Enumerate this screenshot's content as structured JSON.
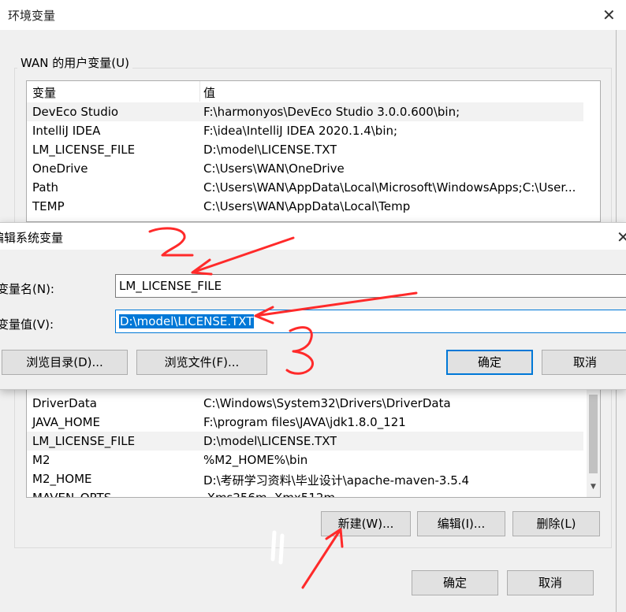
{
  "outer": {
    "title": "环境变量",
    "user_group_label": "WAN 的用户变量(U)",
    "columns": [
      "变量",
      "值"
    ],
    "user_vars": [
      {
        "name": "DevEco Studio",
        "value": "F:\\harmonyos\\DevEco Studio 3.0.0.600\\bin;"
      },
      {
        "name": "IntelliJ IDEA",
        "value": "F:\\idea\\IntelliJ IDEA 2020.1.4\\bin;"
      },
      {
        "name": "LM_LICENSE_FILE",
        "value": "D:\\model\\LICENSE.TXT"
      },
      {
        "name": "OneDrive",
        "value": "C:\\Users\\WAN\\OneDrive"
      },
      {
        "name": "Path",
        "value": "C:\\Users\\WAN\\AppData\\Local\\Microsoft\\WindowsApps;C:\\User..."
      },
      {
        "name": "TEMP",
        "value": "C:\\Users\\WAN\\AppData\\Local\\Temp"
      }
    ],
    "system_vars": [
      {
        "name": "DriverData",
        "value": "C:\\Windows\\System32\\Drivers\\DriverData"
      },
      {
        "name": "JAVA_HOME",
        "value": "F:\\program files\\JAVA\\jdk1.8.0_121"
      },
      {
        "name": "LM_LICENSE_FILE",
        "value": "D:\\model\\LICENSE.TXT"
      },
      {
        "name": "M2",
        "value": "%M2_HOME%\\bin"
      },
      {
        "name": "M2_HOME",
        "value": "D:\\考研学习资料\\毕业设计\\apache-maven-3.5.4"
      },
      {
        "name": "MAVEN_OPTS",
        "value": "-Xms256m -Xmx512m"
      }
    ],
    "system_buttons": {
      "new": "新建(W)...",
      "edit": "编辑(I)...",
      "delete": "删除(L)"
    },
    "footer_buttons": {
      "ok": "确定",
      "cancel": "取消"
    }
  },
  "inner": {
    "title": "编辑系统变量",
    "name_label": "变量名(N):",
    "value_label": "变量值(V):",
    "name_value": "LM_LICENSE_FILE",
    "value_value": "D:\\model\\LICENSE.TXT",
    "buttons": {
      "browse_dir": "浏览目录(D)...",
      "browse_file": "浏览文件(F)...",
      "ok": "确定",
      "cancel": "取消"
    }
  },
  "annotations": {
    "step1": "1",
    "step2": "2",
    "step3": "3",
    "color": "#ff2a2a"
  },
  "icons": {
    "close": "close-icon",
    "scroll_up": "scroll-up-arrow-icon",
    "scroll_down": "scroll-down-arrow-icon"
  }
}
